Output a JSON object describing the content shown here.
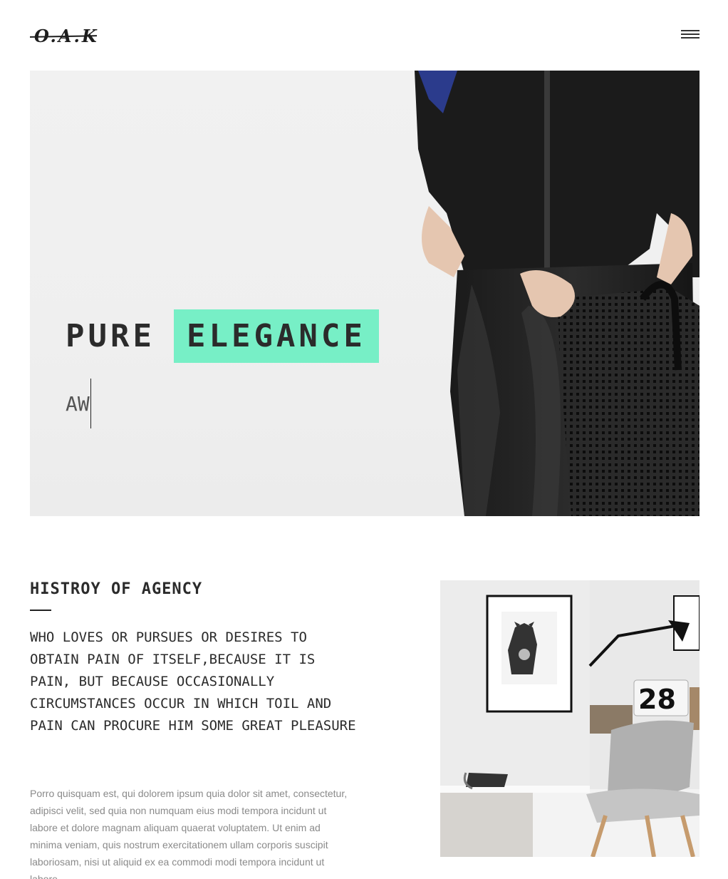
{
  "header": {
    "logo_text": "O.A.K",
    "menu_icon": "hamburger-menu-icon"
  },
  "hero": {
    "title_word1": "PURE",
    "title_word2": "ELEGANCE",
    "typed_text": "AW",
    "accent_color": "#77efc6",
    "image": "woman-in-black-outfit-holding-bag"
  },
  "about": {
    "title": "HISTROY OF AGENCY",
    "lead": "WHO LOVES OR PURSUES OR DESIRES TO OBTAIN PAIN OF ITSELF,BECAUSE IT IS PAIN, BUT BECAUSE OCCASIONALLY CIRCUMSTANCES OCCUR IN WHICH TOIL AND PAIN CAN PROCURE HIM SOME GREAT PLEASURE",
    "body": "Porro quisquam est, qui dolorem ipsum quia dolor sit amet, consectetur, adipisci velit, sed quia non numquam eius modi tempora incidunt ut labore et dolore magnam aliquam quaerat voluptatem. Ut enim ad minima veniam, quis nostrum exercitationem ullam corporis suscipit laboriosam, nisi ut aliquid ex ea commodi modi tempora incidunt ut labore"
  },
  "collage": {
    "calendar_day": "28",
    "image": "interior-room-with-bear-poster-lamp-chair"
  }
}
